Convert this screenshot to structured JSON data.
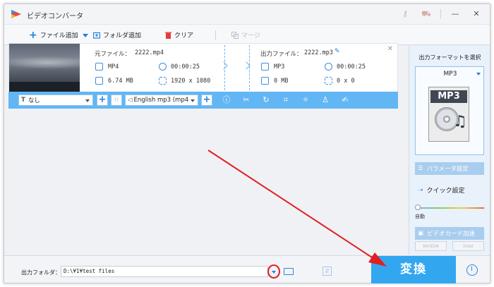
{
  "titlebar": {
    "title": "ビデオコンバータ"
  },
  "toolbar": {
    "add_file": "ファイル追加",
    "add_folder": "フォルダ追加",
    "clear": "クリア",
    "merge": "マージ"
  },
  "file_item": {
    "source_label": "元ファイル：",
    "source_name": "2222.mp4",
    "source_format": "MP4",
    "source_duration": "00:00:25",
    "source_size": "6.74 MB",
    "source_resolution": "1920 x 1080",
    "output_label": "出力ファイル：",
    "output_name": "2222.mp3",
    "output_format": "MP3",
    "output_duration": "00:00:25",
    "output_size": "0 MB",
    "output_resolution": "0 x 0"
  },
  "controls": {
    "subtitle_value": "なし",
    "audio_track_value": "English mp3 (mp4"
  },
  "right_panel": {
    "title": "出力フォーマットを選択",
    "format_name": "MP3",
    "format_icon_text": "MP3",
    "param_settings": "パラメータ設定",
    "quick_settings": "クイック設定",
    "auto_label": "自動",
    "gpu_accel": "ビデオカード加速",
    "nvidia": "NVIDIA",
    "intel": "Intel"
  },
  "bottom": {
    "output_folder_label": "出力フォルダ：",
    "output_path": "D:\\¥1¥test files",
    "convert": "変換"
  },
  "colors": {
    "accent": "#32a7f0",
    "control_bar": "#63b6f4",
    "annotation_red": "#e01f1f"
  }
}
